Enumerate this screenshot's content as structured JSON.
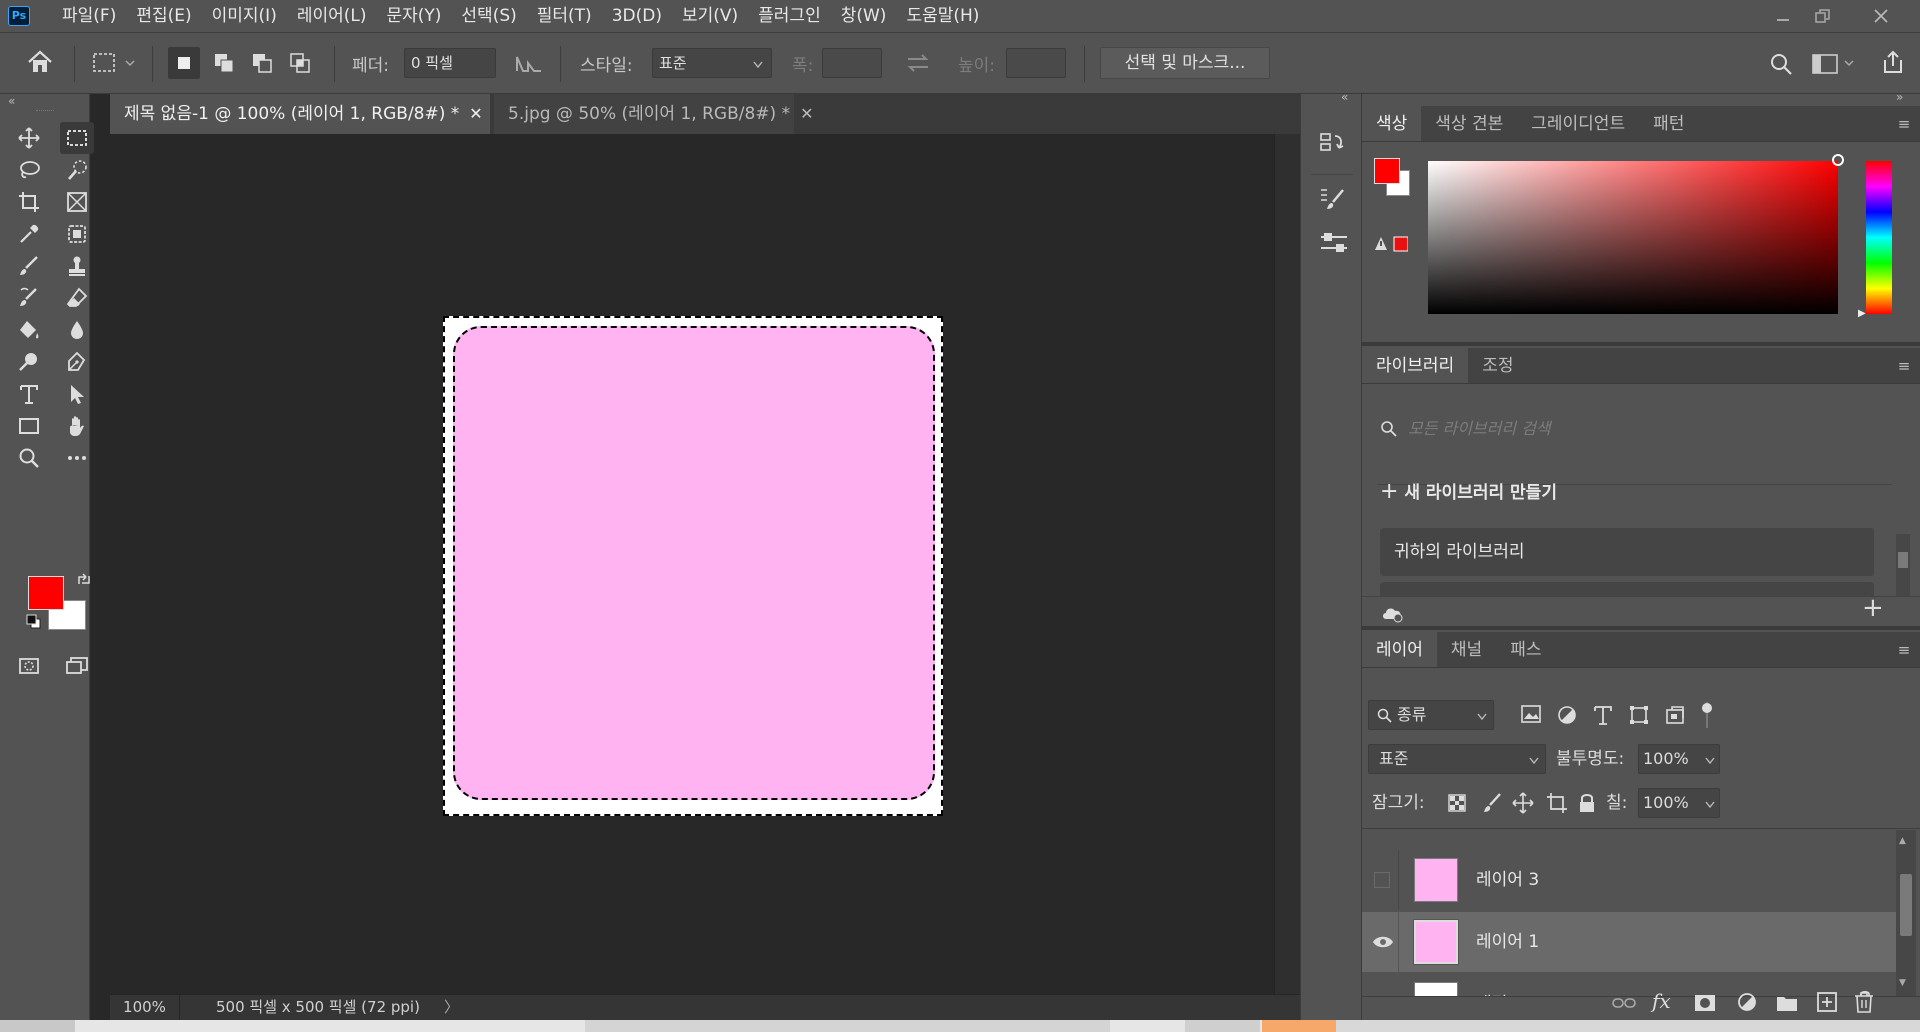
{
  "app": {
    "logo": "Ps"
  },
  "menu": [
    {
      "label": "파일(F)"
    },
    {
      "label": "편집(E)"
    },
    {
      "label": "이미지(I)"
    },
    {
      "label": "레이어(L)"
    },
    {
      "label": "문자(Y)"
    },
    {
      "label": "선택(S)"
    },
    {
      "label": "필터(T)"
    },
    {
      "label": "3D(D)"
    },
    {
      "label": "보기(V)"
    },
    {
      "label": "플러그인"
    },
    {
      "label": "창(W)"
    },
    {
      "label": "도움말(H)"
    }
  ],
  "options": {
    "feather_label": "페더:",
    "feather_value": "0 픽셀",
    "style_label": "스타일:",
    "style_value": "표준",
    "width_label": "폭:",
    "height_label": "높이:",
    "select_mask_button": "선택 및 마스크..."
  },
  "tabs": [
    {
      "label": "제목 없음-1 @ 100% (레이어 1, RGB/8#) *",
      "active": true
    },
    {
      "label": "5.jpg @ 50% (레이어 1, RGB/8#) *",
      "active": false
    }
  ],
  "status": {
    "zoom": "100%",
    "doc_info": "500 픽셀 x 500 픽셀 (72 ppi)"
  },
  "colors": {
    "foreground": "#ff0000",
    "background": "#ffffff",
    "layer_fill": "#ffb3f1",
    "canvas_bg": "#ffffff"
  },
  "color_panel": {
    "tabs": [
      "색상",
      "색상 견본",
      "그레이디언트",
      "패턴"
    ]
  },
  "library_panel": {
    "tabs": [
      "라이브러리",
      "조정"
    ],
    "search_placeholder": "모든 라이브러리 검색",
    "create_label": "새 라이브러리 만들기",
    "your_library": "귀하의 라이브러리"
  },
  "layers_panel": {
    "tabs": [
      "레이어",
      "채널",
      "패스"
    ],
    "filter_kind": "종류",
    "blend_mode": "표준",
    "opacity_label": "불투명도:",
    "opacity_value": "100%",
    "lock_label": "잠그기:",
    "fill_label": "칠:",
    "fill_value": "100%",
    "layers": [
      {
        "name": "레이어 3",
        "visible": false,
        "selected": false
      },
      {
        "name": "레이어 1",
        "visible": true,
        "selected": true
      },
      {
        "name": "배경",
        "visible": true,
        "selected": false
      }
    ]
  }
}
